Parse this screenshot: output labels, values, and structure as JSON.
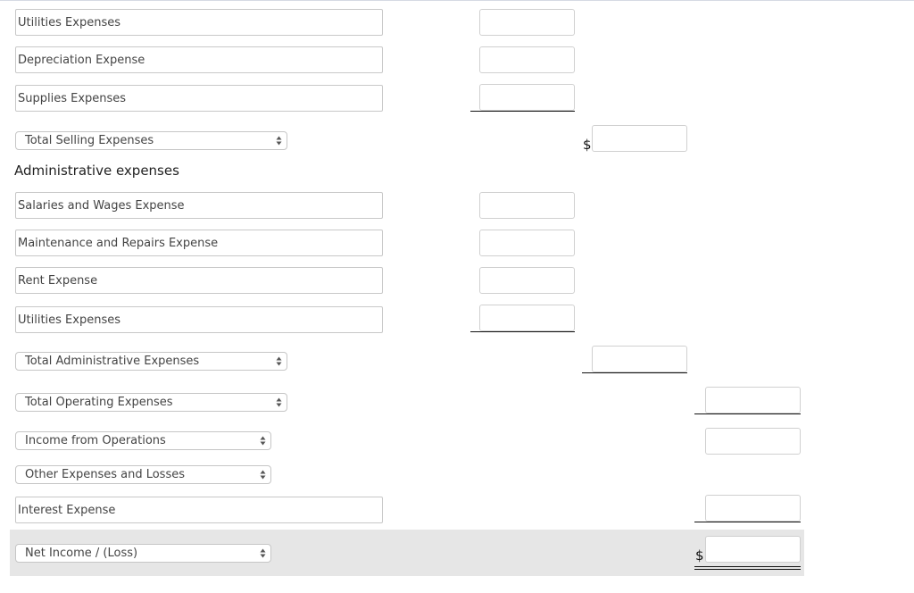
{
  "selling_expenses": {
    "rows": [
      {
        "label": "Utilities Expenses",
        "amount": ""
      },
      {
        "label": "Depreciation Expense",
        "amount": ""
      },
      {
        "label": "Supplies Expenses",
        "amount": ""
      }
    ],
    "total_select": "Total Selling Expenses",
    "total_amount": "",
    "currency_symbol": "$"
  },
  "administrative_expenses": {
    "heading": "Administrative expenses",
    "rows": [
      {
        "label": "Salaries and Wages Expense",
        "amount": ""
      },
      {
        "label": "Maintenance and Repairs Expense",
        "amount": ""
      },
      {
        "label": "Rent Expense",
        "amount": ""
      },
      {
        "label": "Utilities Expenses",
        "amount": ""
      }
    ],
    "total_select": "Total Administrative Expenses",
    "total_amount": ""
  },
  "operating": {
    "total_select": "Total Operating Expenses",
    "total_amount": "",
    "income_select": "Income from Operations",
    "income_amount": ""
  },
  "other": {
    "select": "Other Expenses and Losses",
    "interest_label": "Interest Expense",
    "interest_amount": ""
  },
  "net_income": {
    "select": "Net Income / (Loss)",
    "amount": "",
    "currency_symbol": "$"
  },
  "colors": {
    "highlight_row": "#e6e6e6",
    "input_border": "#c8c8c8"
  }
}
